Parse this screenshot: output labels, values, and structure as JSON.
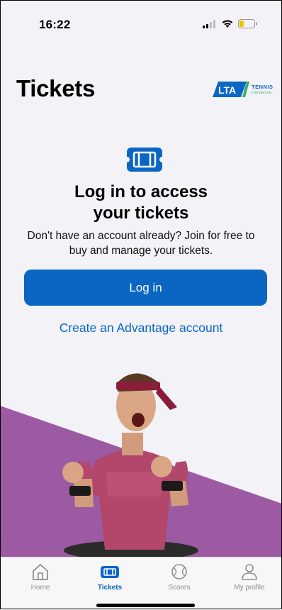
{
  "status_bar": {
    "time": "16:22",
    "icons": [
      "cellular-icon",
      "wifi-icon",
      "battery-icon"
    ]
  },
  "header": {
    "title": "Tickets",
    "logo_text_main": "LTA",
    "logo_text_side": "TENNIS",
    "logo_text_small": "FOR BRITAIN"
  },
  "hero": {
    "icon": "ticket-icon",
    "heading_line1": "Log in to access",
    "heading_line2": "your tickets",
    "subtitle_line1": "Don't have an account already? Join for free to",
    "subtitle_line2": "buy and manage your tickets."
  },
  "actions": {
    "login_label": "Log in",
    "create_account_label": "Create an Advantage account"
  },
  "tab_bar": {
    "items": [
      {
        "label": "Home",
        "icon": "home-icon",
        "active": false
      },
      {
        "label": "Tickets",
        "icon": "ticket-icon",
        "active": true
      },
      {
        "label": "Scores",
        "icon": "tennis-ball-icon",
        "active": false
      },
      {
        "label": "My profile",
        "icon": "person-icon",
        "active": false
      }
    ]
  },
  "colors": {
    "brand_blue": "#0b66c3",
    "purple_band": "#9c5aa3",
    "background": "#f2f2f7"
  }
}
